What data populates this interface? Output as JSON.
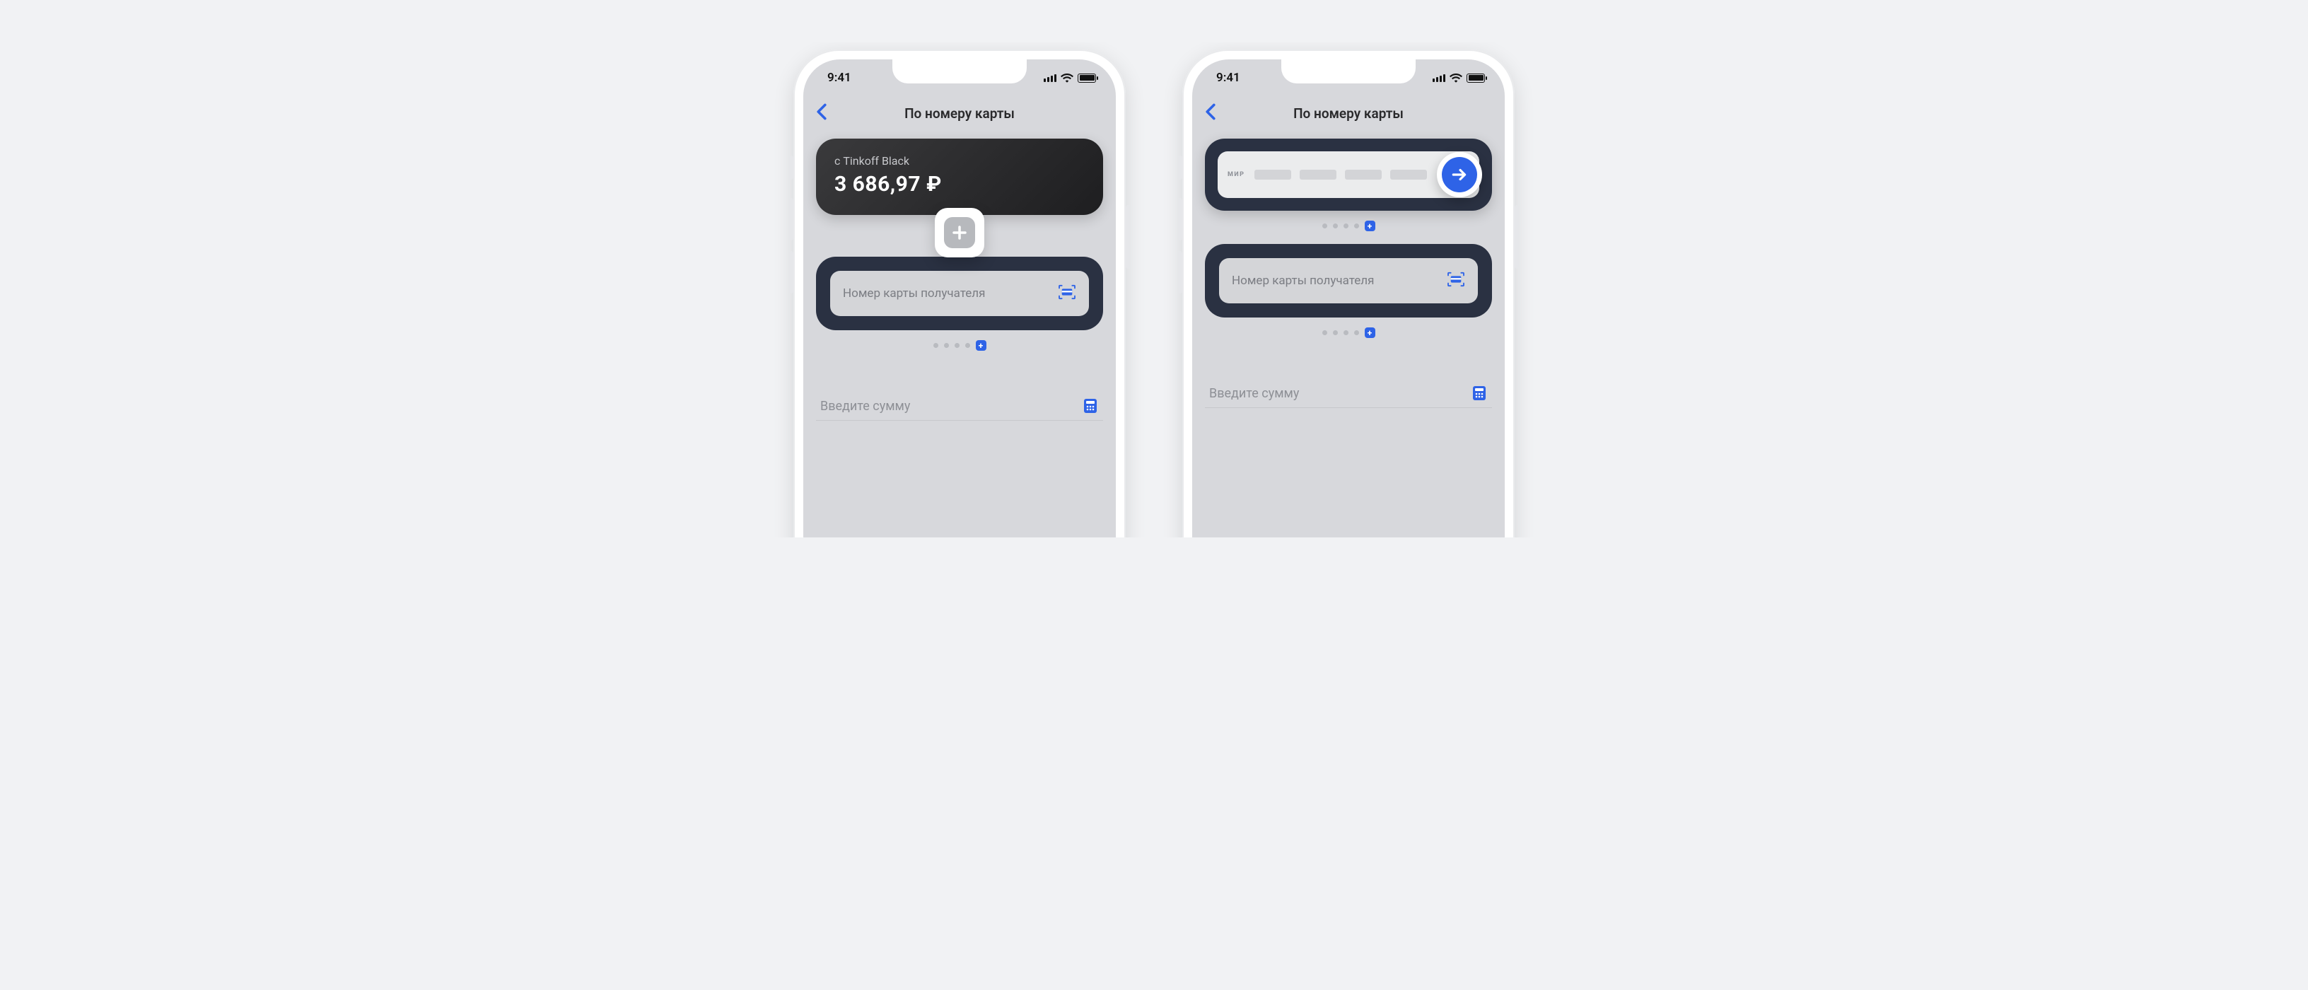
{
  "status": {
    "time": "9:41"
  },
  "nav": {
    "title": "По номеру карты"
  },
  "phone1": {
    "source": {
      "label": "с Tinkoff Black",
      "amount": "3 686,97 ₽"
    }
  },
  "phone2": {
    "source": {
      "scheme": "МИР"
    }
  },
  "dest": {
    "placeholder": "Номер карты получателя"
  },
  "amount": {
    "placeholder": "Введите сумму"
  }
}
